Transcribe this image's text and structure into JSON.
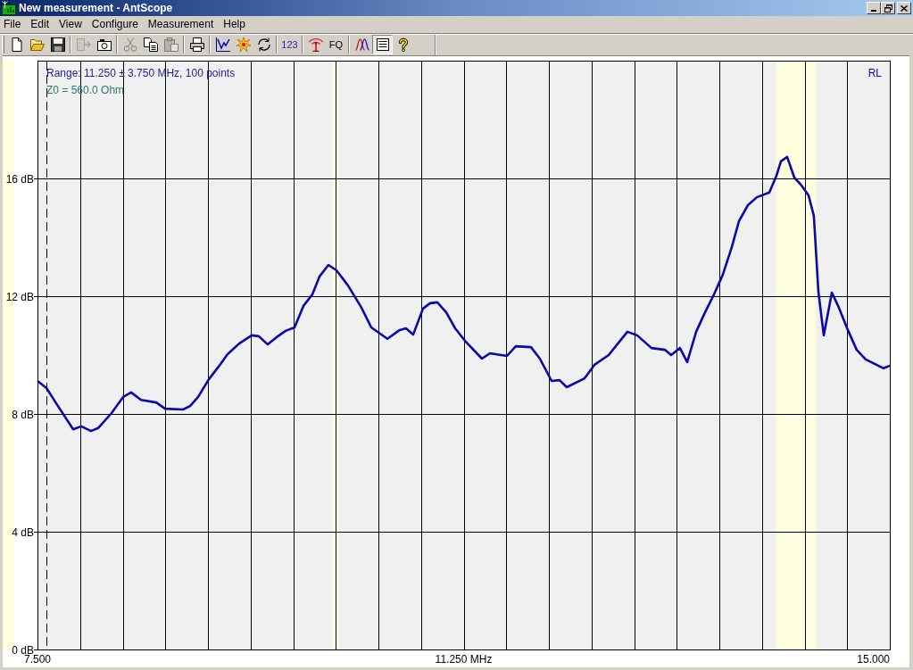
{
  "window": {
    "title": "New measurement - AntScope"
  },
  "menu": [
    "File",
    "Edit",
    "View",
    "Configure",
    "Measurement",
    "Help"
  ],
  "toolbar": {
    "groups": [
      {
        "buttons": [
          {
            "pressed": false,
            "disabled": false
          },
          {
            "pressed": false,
            "disabled": false
          },
          {
            "pressed": false,
            "disabled": false
          }
        ]
      },
      {
        "buttons": [
          {
            "pressed": false,
            "disabled": true
          },
          {
            "pressed": false,
            "disabled": false
          }
        ]
      },
      {
        "buttons": [
          {
            "pressed": false,
            "disabled": true
          },
          {
            "pressed": false,
            "disabled": false
          },
          {
            "pressed": false,
            "disabled": true
          }
        ]
      },
      {
        "buttons": [
          {
            "pressed": false,
            "disabled": false
          }
        ]
      },
      {
        "buttons": [
          {
            "pressed": false,
            "disabled": false
          },
          {
            "pressed": false,
            "disabled": false
          },
          {
            "pressed": false,
            "disabled": false
          }
        ]
      },
      {
        "buttons": [
          {
            "label": "123",
            "color": "#1c1ccc",
            "pressed": false,
            "disabled": false
          }
        ]
      },
      {
        "buttons": [
          {
            "pressed": false,
            "disabled": false
          },
          {
            "label": "FQ",
            "color": "#000000",
            "pressed": false,
            "disabled": false
          }
        ]
      },
      {
        "buttons": [
          {
            "pressed": false,
            "disabled": false
          },
          {
            "pressed": true,
            "disabled": false
          },
          {
            "pressed": false,
            "disabled": false
          }
        ]
      }
    ]
  },
  "chart": {
    "range_info": "Range: 11.250 ± 3.750 MHz, 100 points",
    "impedance_info": "Z0 = 560.0 Ohm",
    "chart_data": {
      "type": "line",
      "x": [
        7.5,
        7.579,
        7.665,
        7.814,
        7.885,
        7.971,
        8.034,
        8.152,
        8.254,
        8.325,
        8.411,
        8.545,
        8.623,
        8.78,
        8.843,
        8.914,
        9.008,
        9.094,
        9.173,
        9.275,
        9.385,
        9.448,
        9.526,
        9.605,
        9.683,
        9.762,
        9.84,
        9.919,
        9.982,
        10.06,
        10.131,
        10.233,
        10.351,
        10.437,
        10.579,
        10.688,
        10.743,
        10.806,
        10.893,
        10.955,
        11.018,
        11.097,
        11.175,
        11.27,
        11.411,
        11.482,
        11.631,
        11.709,
        11.843,
        11.921,
        12.024,
        12.094,
        12.157,
        12.314,
        12.401,
        12.526,
        12.613,
        12.691,
        12.777,
        12.903,
        13.021,
        13.076,
        13.154,
        13.217,
        13.296,
        13.374,
        13.453,
        13.531,
        13.61,
        13.673,
        13.751,
        13.83,
        13.94,
        14.003,
        14.042,
        14.097,
        14.16,
        14.223,
        14.285,
        14.332,
        14.372,
        14.419,
        14.49,
        14.552,
        14.631,
        14.709,
        14.788,
        14.867,
        14.945,
        15.0
      ],
      "series": [
        {
          "name": "RL",
          "color": "#0a0aa6",
          "values": [
            9.12,
            8.88,
            8.36,
            7.48,
            7.58,
            7.42,
            7.52,
            8.03,
            8.58,
            8.73,
            8.48,
            8.39,
            8.18,
            8.15,
            8.27,
            8.58,
            9.18,
            9.61,
            10.03,
            10.39,
            10.67,
            10.64,
            10.36,
            10.61,
            10.82,
            10.94,
            11.67,
            12.06,
            12.67,
            13.06,
            12.88,
            12.36,
            11.61,
            10.94,
            10.55,
            10.85,
            10.91,
            10.7,
            11.58,
            11.76,
            11.79,
            11.45,
            10.91,
            10.45,
            9.88,
            10.06,
            9.97,
            10.3,
            10.27,
            9.88,
            9.12,
            9.15,
            8.91,
            9.21,
            9.67,
            10.0,
            10.42,
            10.79,
            10.67,
            10.24,
            10.18,
            10.0,
            10.24,
            9.76,
            10.79,
            11.45,
            12.06,
            12.73,
            13.67,
            14.55,
            15.09,
            15.36,
            15.52,
            16.09,
            16.58,
            16.73,
            16.03,
            15.76,
            15.42,
            14.73,
            12.15,
            10.67,
            12.12,
            11.61,
            10.85,
            10.18,
            9.85,
            9.7,
            9.55,
            9.64
          ]
        }
      ],
      "xlim": [
        7.5,
        15
      ],
      "ylim": [
        0,
        20
      ],
      "xticks": [
        {
          "value": 7.5,
          "label": "7.500"
        },
        {
          "value": 11.25,
          "label": "11.250 MHz"
        },
        {
          "value": 15,
          "label": "15.000"
        }
      ],
      "yticks": [
        {
          "value": 0,
          "label": "0 dB"
        },
        {
          "value": 4,
          "label": "4 dB"
        },
        {
          "value": 8,
          "label": "8 dB"
        },
        {
          "value": 12,
          "label": "12 dB"
        },
        {
          "value": 16,
          "label": "16 dB"
        }
      ],
      "grid": true,
      "bands": [
        {
          "axis": "x",
          "from": 7.0,
          "to": 7.3
        },
        {
          "axis": "x",
          "from": 10.1,
          "to": 10.15
        },
        {
          "axis": "x",
          "from": 14.0,
          "to": 14.35
        }
      ],
      "ref_lines": [
        {
          "axis": "x",
          "value": 7.579
        }
      ]
    }
  }
}
